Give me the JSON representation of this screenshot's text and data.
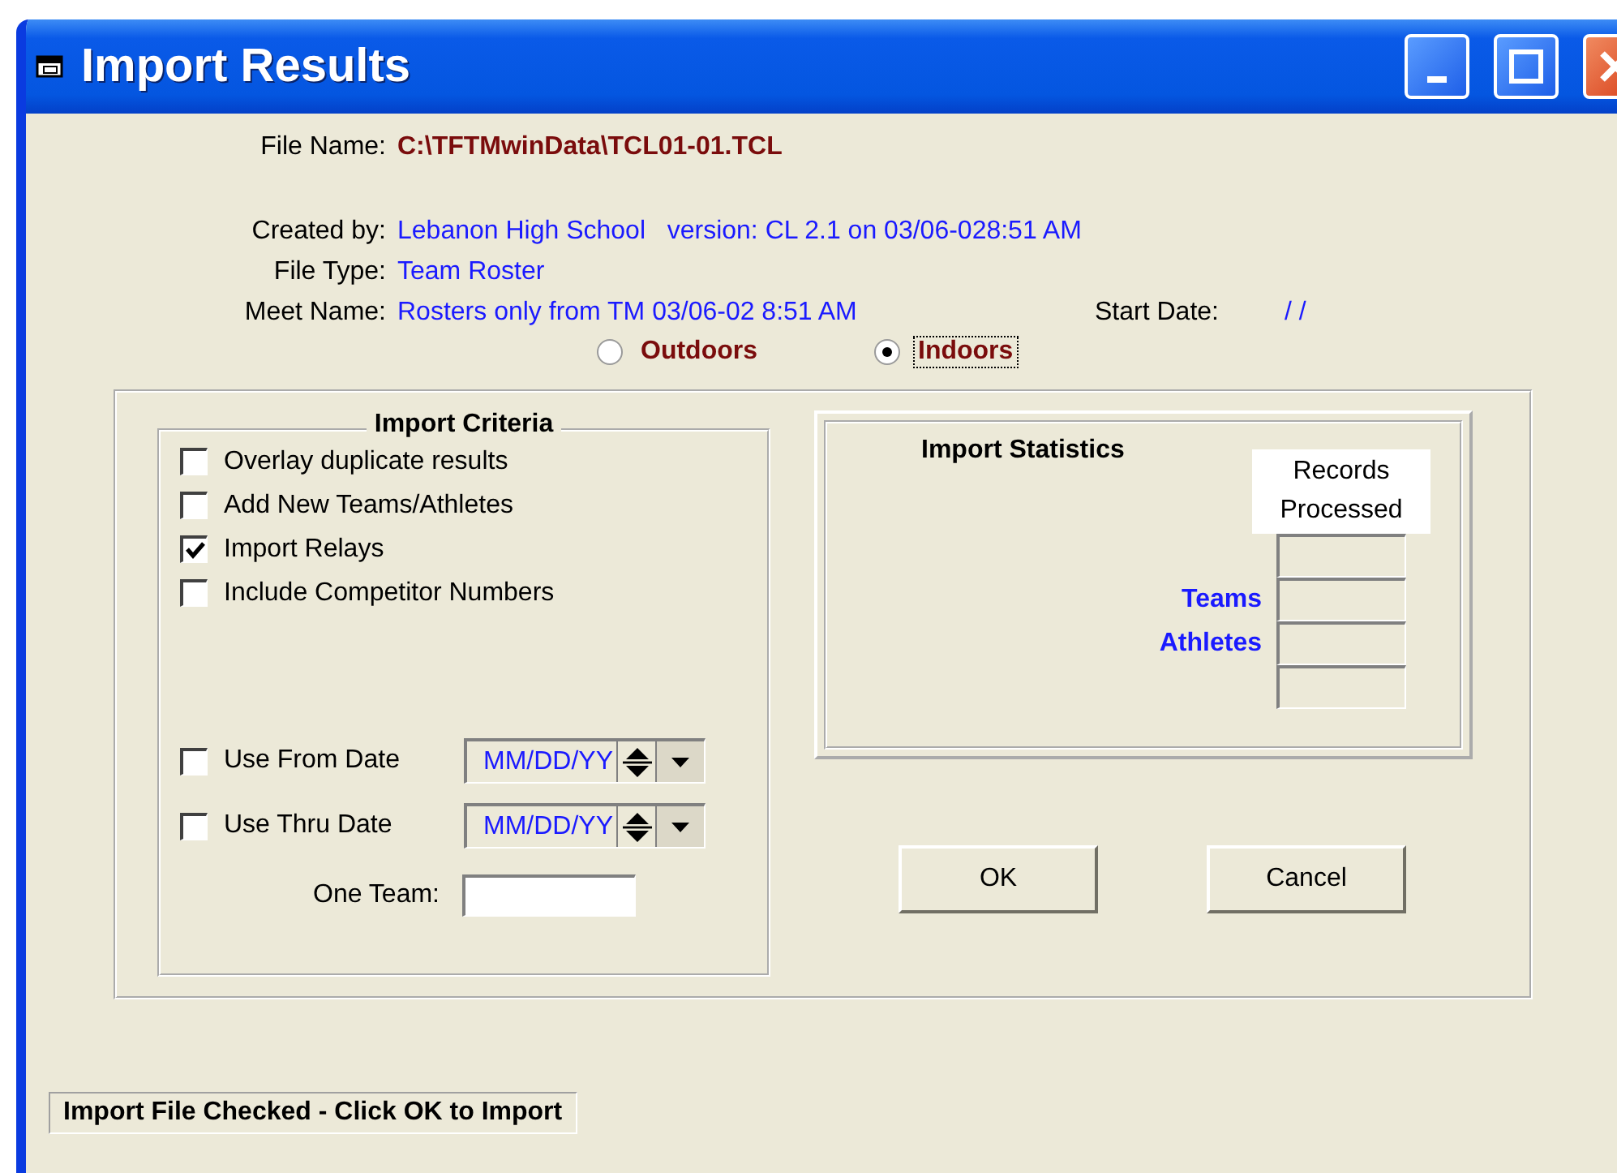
{
  "window": {
    "title": "Import Results"
  },
  "file_name": {
    "label": "File Name:",
    "value": "C:\\TFTMwinData\\TCL01-01.TCL"
  },
  "details": [
    {
      "label": "Created by:",
      "value": "Lebanon High School   version: CL 2.1 on 03/06-028:51 AM"
    },
    {
      "label": "File Type:",
      "value": "Team Roster"
    },
    {
      "label": "Meet Name:",
      "value": "Rosters only from TM 03/06-02 8:51 AM"
    }
  ],
  "start_date": {
    "label": "Start Date:",
    "value": "/ /"
  },
  "venue_options": [
    {
      "label": "Outdoors",
      "selected": false
    },
    {
      "label": "Indoors",
      "selected": true
    }
  ],
  "import_criteria": {
    "title": "Import Criteria",
    "options": [
      {
        "label": "Overlay duplicate results",
        "checked": false
      },
      {
        "label": "Add New Teams/Athletes",
        "checked": false
      },
      {
        "label": "Import Relays",
        "checked": true
      },
      {
        "label": "Include Competitor Numbers",
        "checked": false
      }
    ],
    "date_filters": [
      {
        "label": "Use From Date",
        "checked": false,
        "value": "MM/DD/YY"
      },
      {
        "label": "Use Thru Date",
        "checked": false,
        "value": "MM/DD/YY"
      }
    ],
    "one_team": {
      "label": "One Team:"
    }
  },
  "import_statistics": {
    "title": "Import Statistics",
    "column_header": "Records Processed",
    "rows": [
      {
        "kind": "blank"
      },
      {
        "kind": "labeled",
        "label": "Teams"
      },
      {
        "kind": "labeled",
        "label": "Athletes"
      },
      {
        "kind": "blank"
      }
    ]
  },
  "buttons": [
    {
      "label": "OK"
    },
    {
      "label": "Cancel"
    }
  ],
  "status_bar": {
    "text": "Import File Checked - Click OK to Import"
  }
}
